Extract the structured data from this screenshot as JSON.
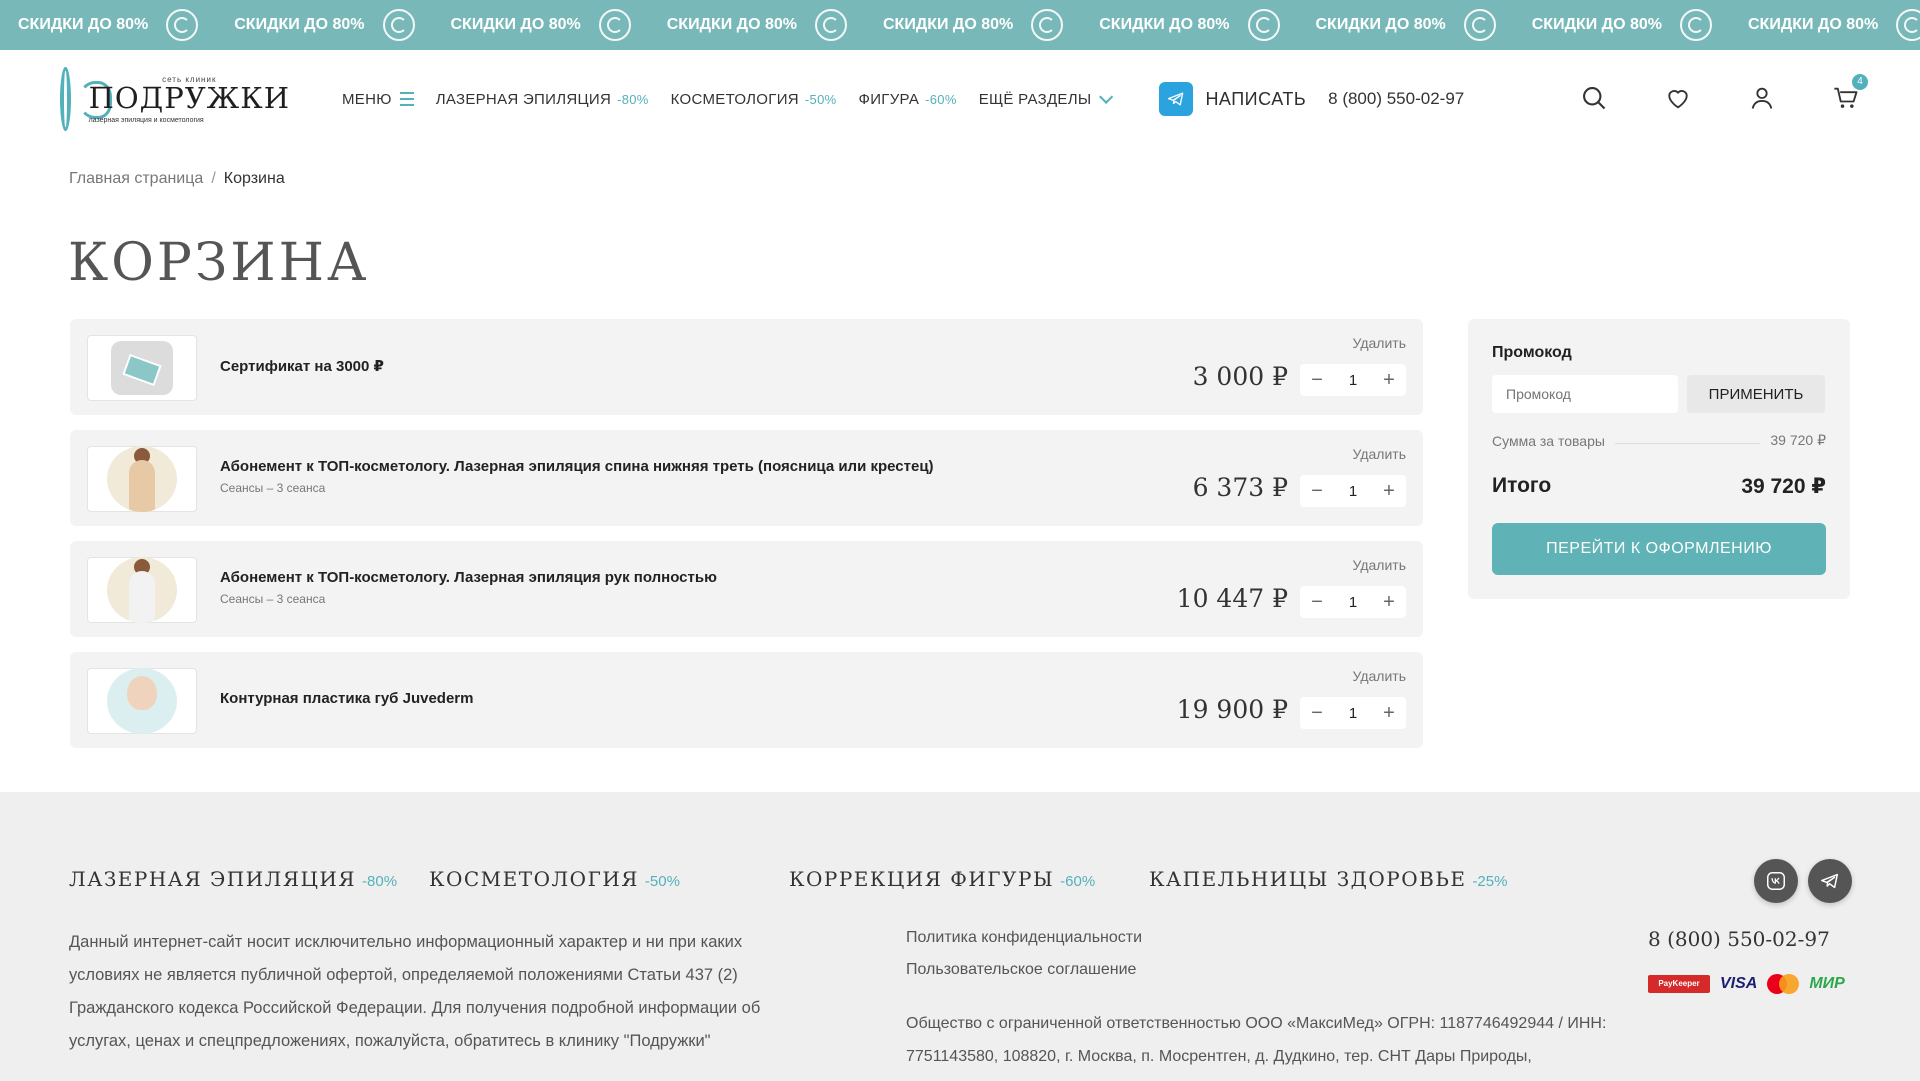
{
  "ticker": {
    "text": "СКИДКИ ДО 80%",
    "repeat": 10
  },
  "header": {
    "logo": {
      "top": "сеть клиник",
      "name": "ПОДРУЖКИ",
      "sub": "лазерная эпиляция и косметология"
    },
    "nav": {
      "menu": "МЕНЮ",
      "laser": "ЛАЗЕРНАЯ ЭПИЛЯЦИЯ",
      "laser_disc": "-80%",
      "cosmo": "КОСМЕТОЛОГИЯ",
      "cosmo_disc": "-50%",
      "figure": "ФИГУРА",
      "figure_disc": "-60%",
      "more": "ЕЩЁ РАЗДЕЛЫ"
    },
    "write": "НАПИСАТЬ",
    "phone": "8 (800) 550-02-97",
    "cart_count": "4",
    "icons": [
      "search-icon",
      "heart-icon",
      "user-icon",
      "cart-icon"
    ]
  },
  "breadcrumbs": {
    "home": "Главная страница",
    "sep": "/",
    "current": "Корзина"
  },
  "page_title": "КОРЗИНА",
  "cart": {
    "delete_label": "Удалить",
    "items": [
      {
        "title": "Сертификат на 3000 ₽",
        "subtitle": "",
        "price": "3 000 ₽",
        "qty": "1"
      },
      {
        "title": "Абонемент к ТОП-косметологу. Лазерная эпиляция спина нижняя треть (поясница или крестец)",
        "subtitle": "Сеансы – 3 сеанса",
        "price": "6 373 ₽",
        "qty": "1"
      },
      {
        "title": "Абонемент к ТОП-косметологу. Лазерная эпиляция рук полностью",
        "subtitle": "Сеансы – 3 сеанса",
        "price": "10 447 ₽",
        "qty": "1"
      },
      {
        "title": "Контурная пластика губ Juvederm",
        "subtitle": "",
        "price": "19 900 ₽",
        "qty": "1"
      }
    ],
    "minus": "−",
    "plus": "+"
  },
  "summary": {
    "promo_label": "Промокод",
    "promo_placeholder": "Промокод",
    "apply": "ПРИМЕНИТЬ",
    "subtotal_label": "Сумма за товары",
    "subtotal": "39 720 ₽",
    "total_label": "Итого",
    "total": "39 720 ₽",
    "checkout": "ПЕРЕЙТИ К ОФОРМЛЕНИЮ"
  },
  "footer": {
    "categories": [
      {
        "name": "ЛАЗЕРНАЯ ЭПИЛЯЦИЯ",
        "disc": "-80%"
      },
      {
        "name": "КОСМЕТОЛОГИЯ",
        "disc": "-50%"
      },
      {
        "name": "КОРРЕКЦИЯ ФИГУРЫ",
        "disc": "-60%"
      },
      {
        "name": "КАПЕЛЬНИЦЫ ЗДОРОВЬЕ",
        "disc": "-25%"
      }
    ],
    "disclaimer": "Данный интернет-сайт носит исключительно информационный характер и ни при каких условиях не является публичной офертой, определяемой положениями Статьи 437 (2) Гражданского кодекса Российской Федерации. Для получения подробной информации об услугах, ценах и спецпредложениях, пожалуйста, обратитесь в клинику \"Подружки\"",
    "privacy": "Политика конфиденциальности",
    "agreement": "Пользовательское соглашение",
    "company": "Общество с ограниченной ответственностью ООО «МаксиМед» ОГРН: 1187746492944 / ИНН: 7751143580, 108820, г. Москва, п. Мосрентген, д. Дудкино, тер. СНТ Дары Природы,",
    "phone": "8 (800) 550-02-97",
    "payments": {
      "paykeeper": "PayKeeper",
      "visa": "VISA",
      "mir": "МИР"
    }
  },
  "colors": {
    "accent": "#53b1ba",
    "ticker_bg": "#79b8b8",
    "button": "#5fb2b5",
    "card_bg": "#f4f3f3",
    "footer_bg": "#f0efef"
  }
}
